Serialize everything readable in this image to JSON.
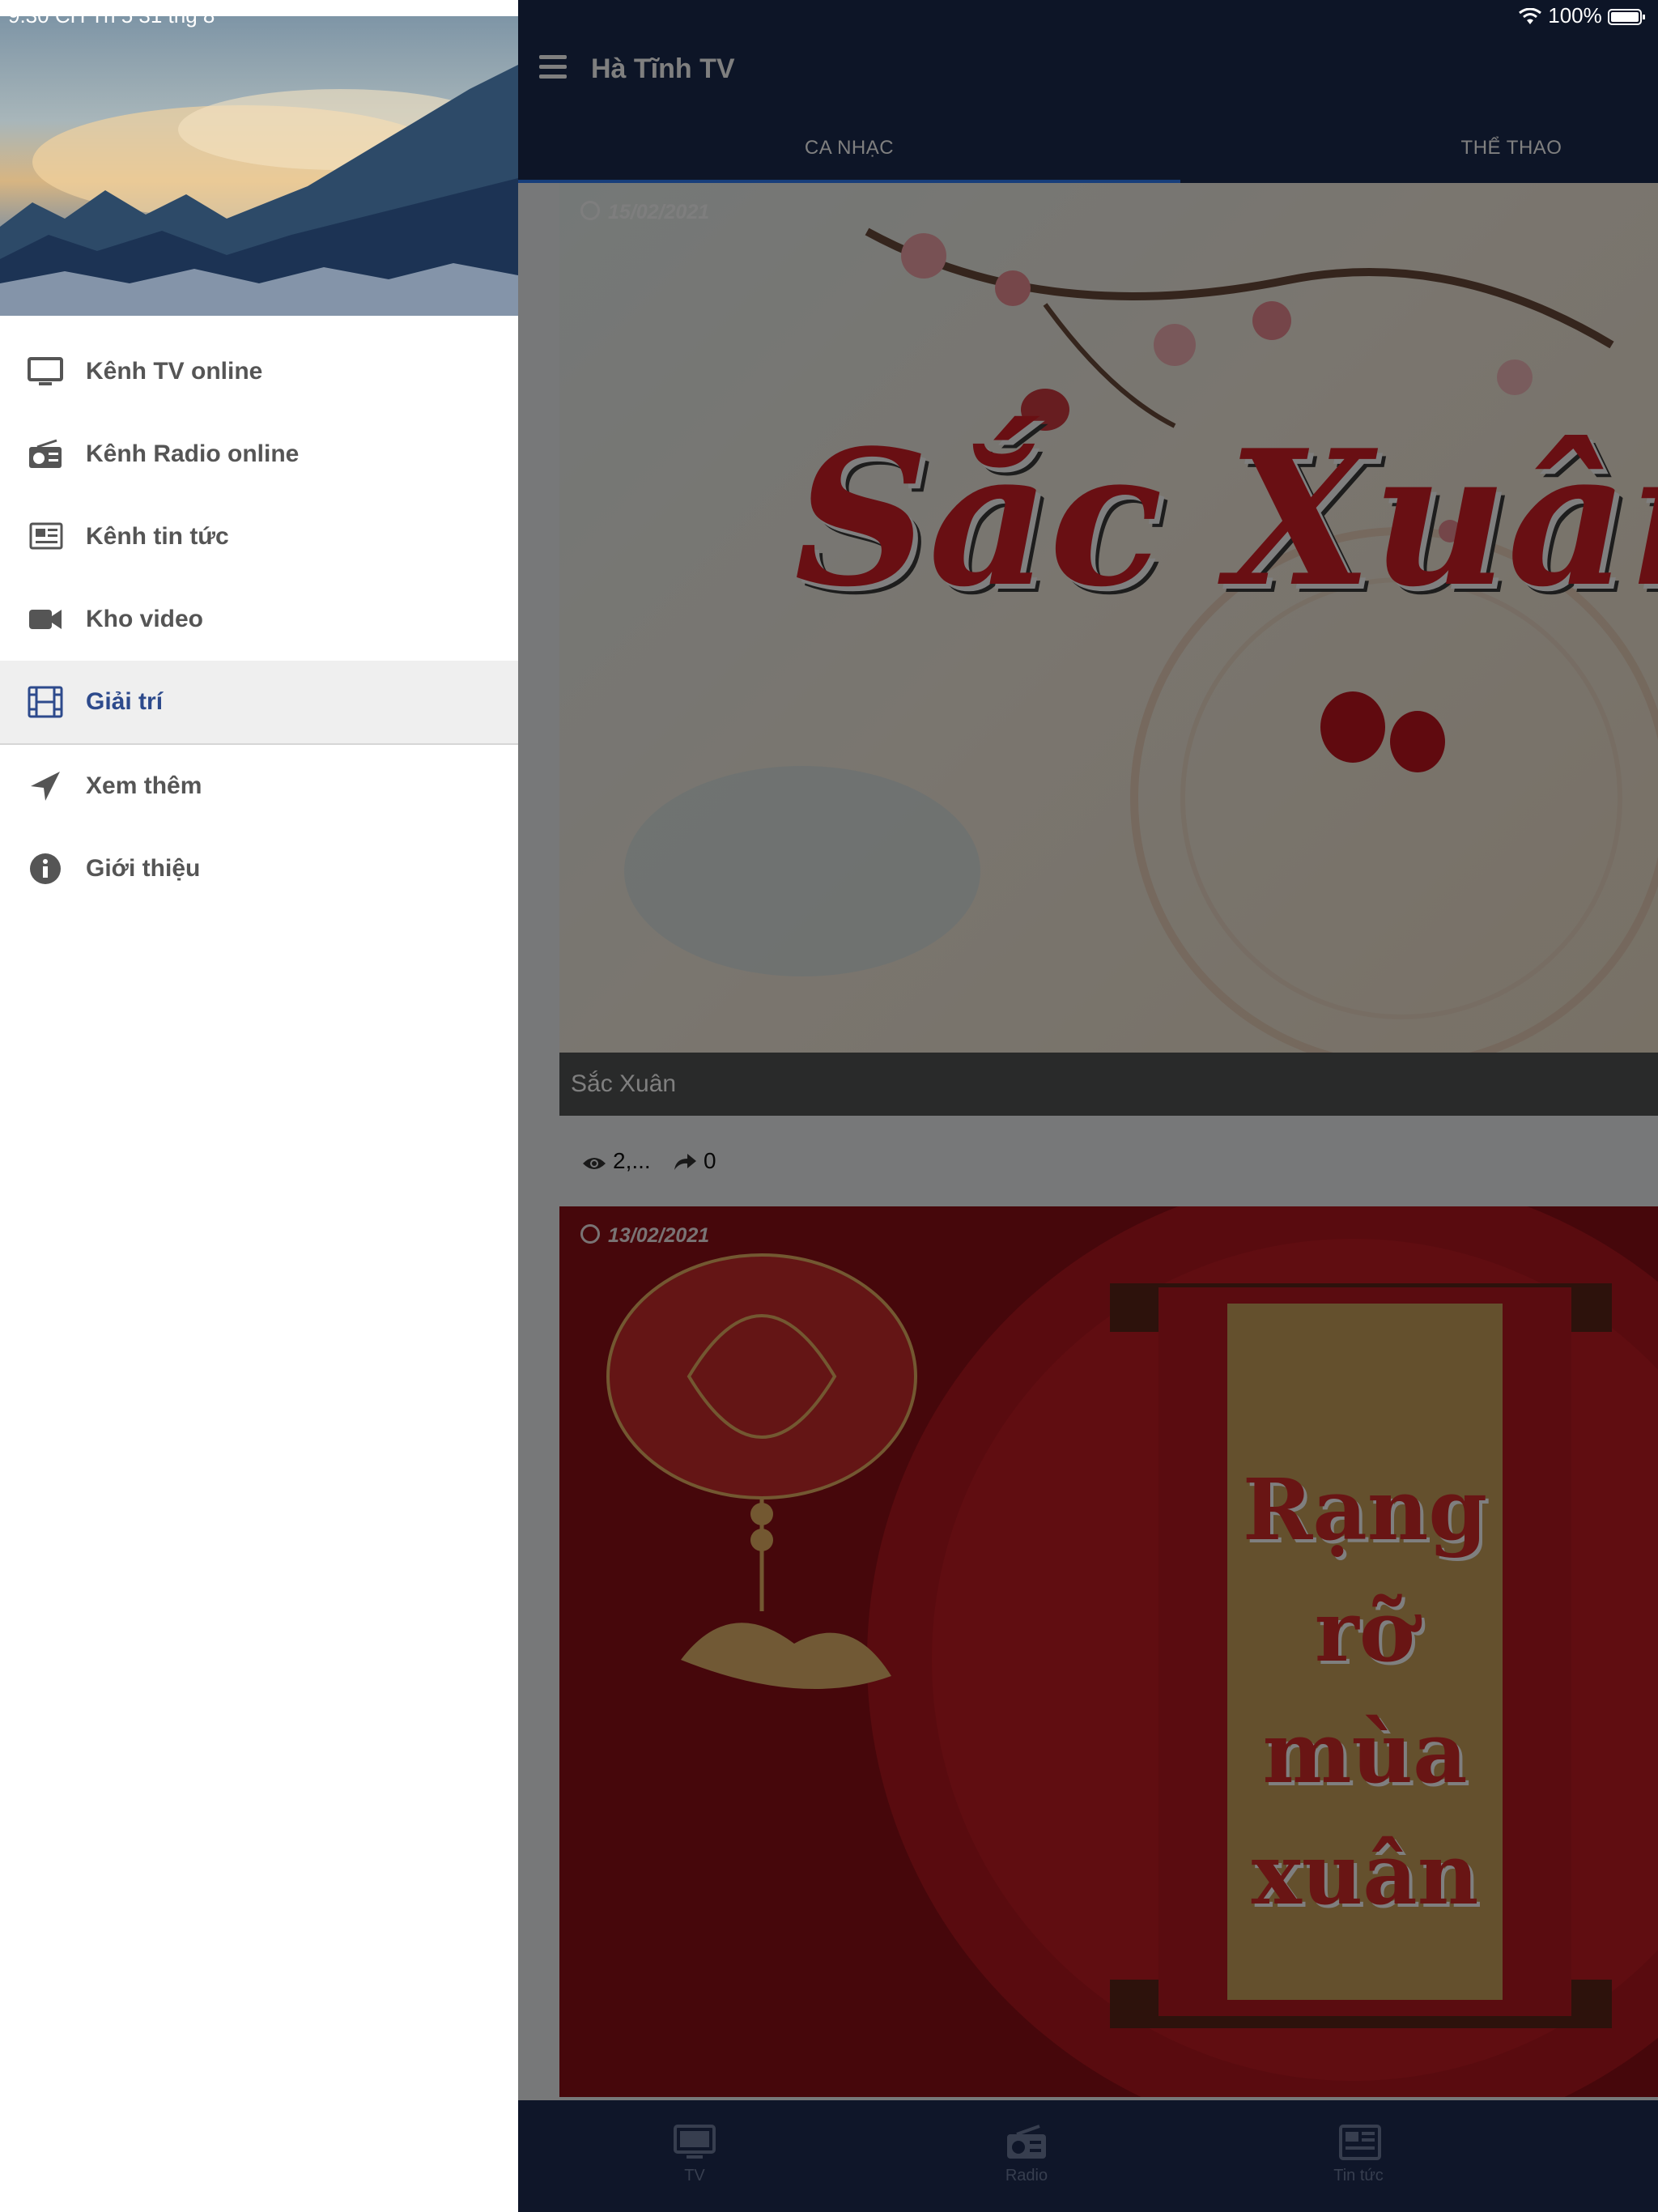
{
  "status_bar": {
    "time": "9:30 CH   Th 5 31 thg 8",
    "battery": "100%"
  },
  "app": {
    "title": "Hà Tĩnh TV"
  },
  "tabs": [
    {
      "label": "CA NHẠC",
      "active": true
    },
    {
      "label": "THỂ THAO",
      "active": false
    }
  ],
  "cards": [
    {
      "date": "15/02/2021",
      "title": "Sắc Xuân",
      "thumb_text": "Sắc Xuân",
      "views": "2,...",
      "shares": "0"
    },
    {
      "date": "13/02/2021",
      "title": "",
      "thumb_text_line1": "Rạng rỡ",
      "thumb_text_line2": "mùa xuân"
    }
  ],
  "bottom_nav": [
    {
      "label": "TV",
      "icon": "tv-icon"
    },
    {
      "label": "Radio",
      "icon": "radio-icon"
    },
    {
      "label": "Tin tức",
      "icon": "newspaper-icon"
    }
  ],
  "drawer": {
    "items": [
      {
        "label": "Kênh TV online",
        "icon": "tv-icon"
      },
      {
        "label": "Kênh Radio online",
        "icon": "radio-icon"
      },
      {
        "label": "Kênh tin tức",
        "icon": "newspaper-icon"
      },
      {
        "label": "Kho video",
        "icon": "video-camera-icon"
      },
      {
        "label": "Giải trí",
        "icon": "film-icon",
        "active": true
      },
      {
        "label": "Xem thêm",
        "icon": "location-arrow-icon"
      },
      {
        "label": "Giới thiệu",
        "icon": "info-icon"
      }
    ]
  },
  "colors": {
    "primary": "#1b2a4e",
    "accent": "#2e7cf6",
    "active_menu": "#2d4a8c"
  }
}
